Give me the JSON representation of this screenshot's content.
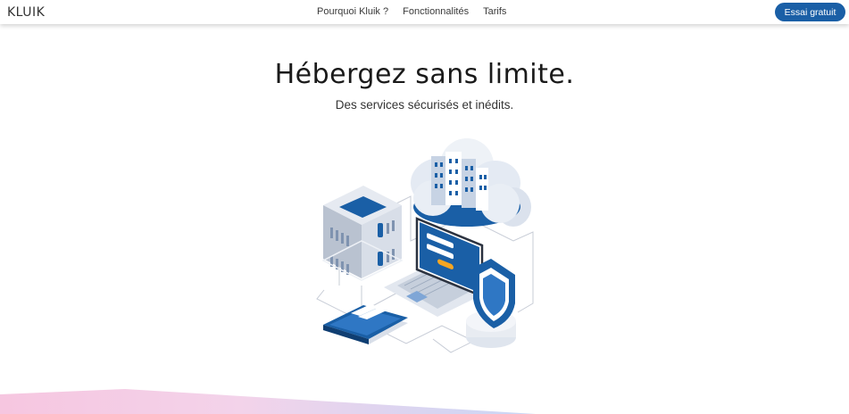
{
  "navbar": {
    "brand": "KLUIK",
    "links": [
      "Pourquoi Kluik ?",
      "Fonctionnalités",
      "Tarifs"
    ],
    "cta_label": "Essai gratuit"
  },
  "hero": {
    "title": "Hébergez sans limite.",
    "subtitle": "Des services sécurisés et inédits."
  },
  "colors": {
    "primary": "#1a5fa6",
    "accent": "#f5a623",
    "band_pink": "#f6c6e0",
    "band_blue": "#c9d6f5"
  },
  "illustration": {
    "icons": [
      "server-icon",
      "cloud-icon",
      "laptop-icon",
      "shield-icon",
      "phone-icon"
    ]
  }
}
